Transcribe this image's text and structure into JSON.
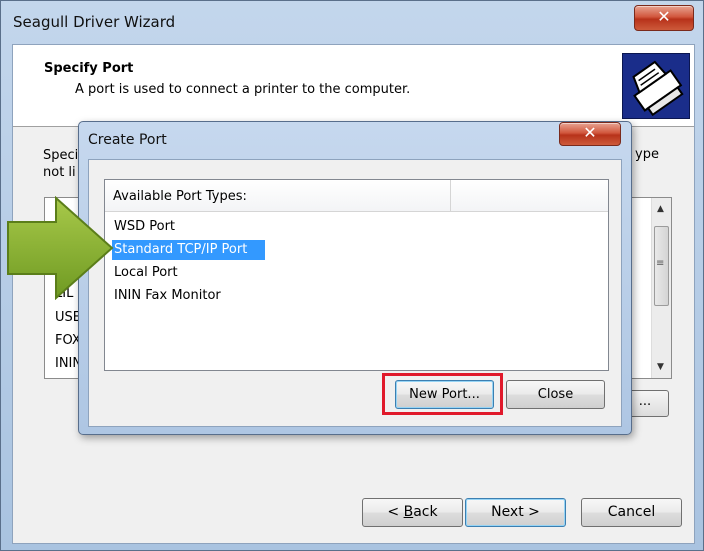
{
  "wizard": {
    "title": "Seagull Driver Wizard",
    "close_label": "✕",
    "header_title": "Specify Port",
    "header_subtitle": "A port is used to connect a printer to the computer.",
    "body_text_line1": "Speci",
    "body_text_line2": "not li",
    "body_text_right": "ype",
    "bg_list_items": [
      "LIL",
      "USE",
      "FOX",
      "ININ"
    ],
    "small_button_label": "...",
    "back_label_prefix": "< ",
    "back_label_accel": "B",
    "back_label_rest": "ack",
    "next_label": "Next >",
    "cancel_label": "Cancel"
  },
  "dialog": {
    "title": "Create Port",
    "close_label": "✕",
    "column_header": "Available Port Types:",
    "port_types": [
      {
        "label": "WSD Port",
        "selected": false
      },
      {
        "label": "Standard TCP/IP Port",
        "selected": true
      },
      {
        "label": "Local Port",
        "selected": false
      },
      {
        "label": "ININ Fax Monitor",
        "selected": false
      }
    ],
    "new_port_label": "New Port...",
    "close_button_label": "Close"
  },
  "colors": {
    "selection": "#3399ff",
    "highlight_box": "#e0192b",
    "arrow": "#8db23a"
  },
  "icons": {
    "scroll_up": "▲",
    "scroll_down": "▼",
    "scroll_grip": "≡"
  }
}
